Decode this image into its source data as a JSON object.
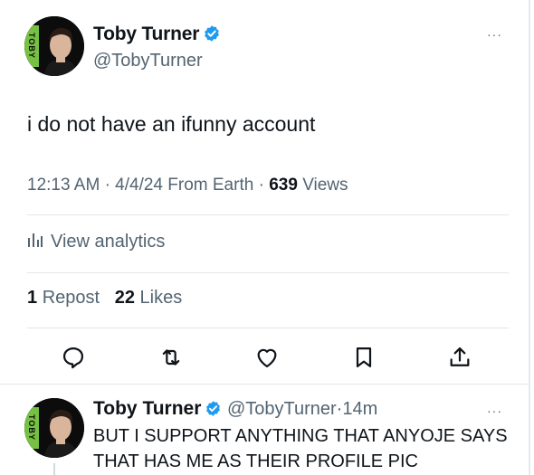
{
  "tweet": {
    "author_name": "Toby Turner",
    "author_handle": "@TobyTurner",
    "avatar_text": "TOBY",
    "text": "i do not have an ifunny account",
    "time": "12:13 AM",
    "date": "4/4/24",
    "source": "From Earth",
    "views_count": "639",
    "views_label": "Views",
    "analytics_label": "View analytics",
    "reposts_count": "1",
    "reposts_label": "Repost",
    "likes_count": "22",
    "likes_label": "Likes",
    "more_label": "···"
  },
  "reply": {
    "author_name": "Toby Turner",
    "author_handle": "@TobyTurner",
    "time_ago": "14m",
    "text": "BUT I SUPPORT ANYTHING THAT ANYOJE SAYS THAT HAS ME AS THEIR PROFILE PIC",
    "more_label": "···"
  },
  "icons": {
    "verified": "verified-badge-icon",
    "analytics": "bar-chart-icon",
    "reply": "comment-icon",
    "repost": "repost-icon",
    "like": "heart-icon",
    "bookmark": "bookmark-icon",
    "share": "share-icon"
  },
  "colors": {
    "verified": "#1d9bf0",
    "text": "#0f1419",
    "secondary": "#536471",
    "divider": "#e1e6ea"
  },
  "separator": "·"
}
